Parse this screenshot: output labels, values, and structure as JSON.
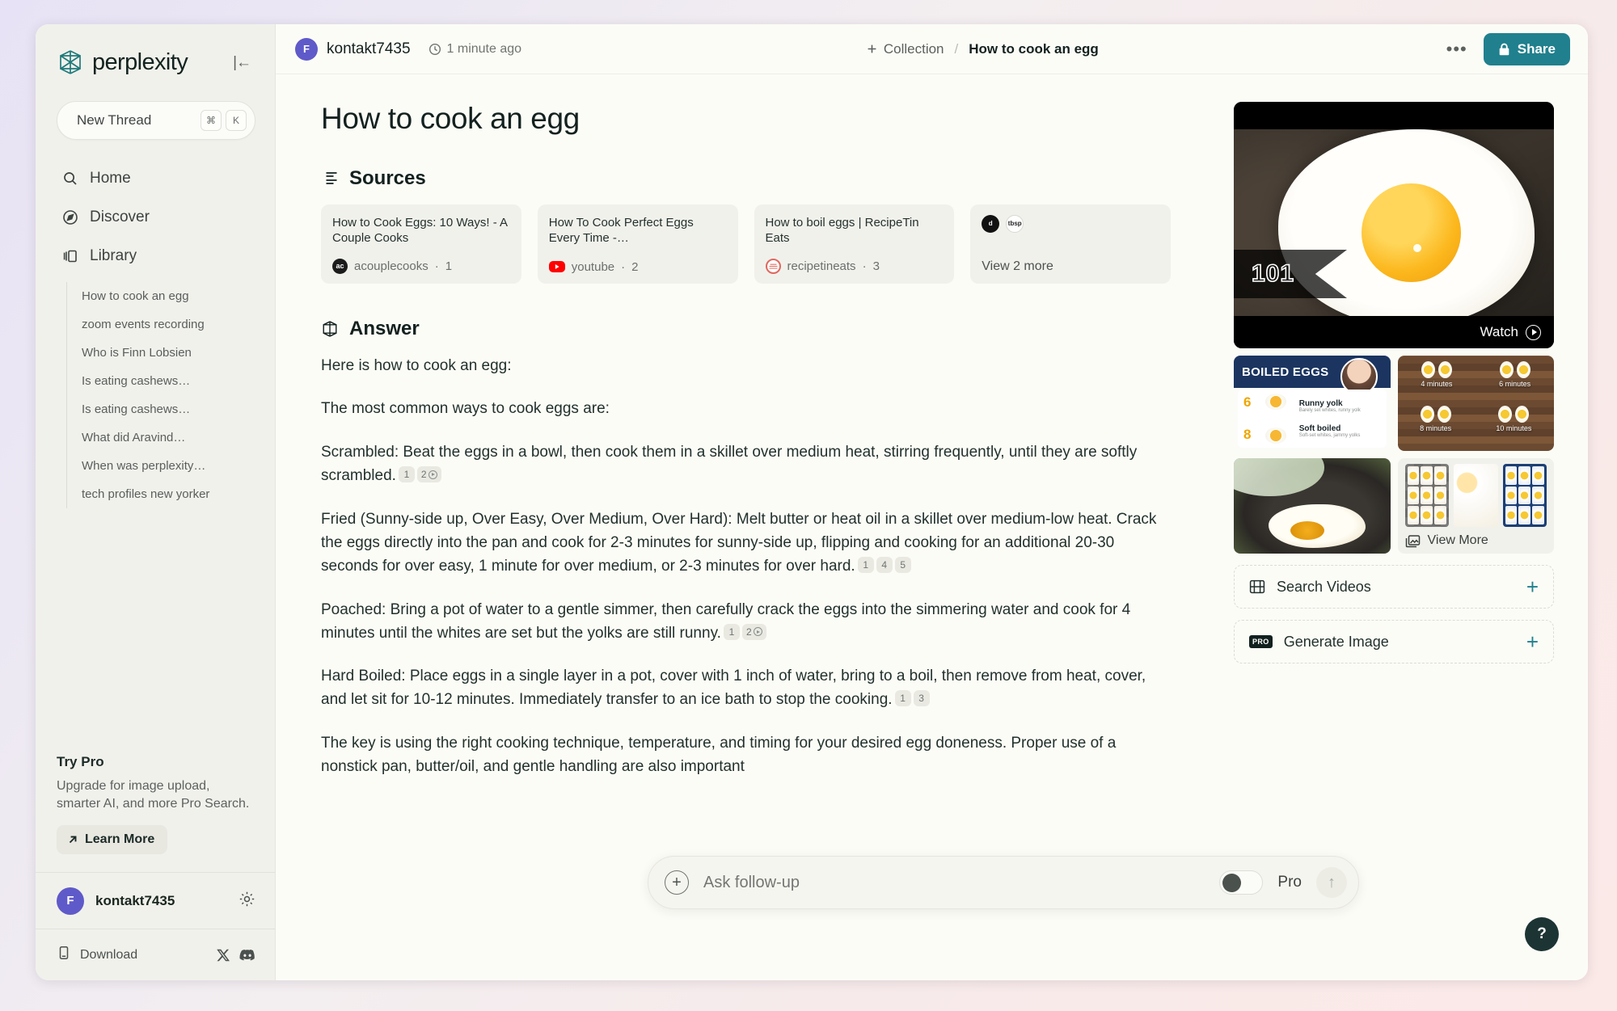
{
  "sidebar": {
    "brand": "perplexity",
    "collapse_icon": "collapse-panel-icon",
    "new_thread": {
      "label": "New Thread",
      "kbd_cmd": "⌘",
      "kbd_key": "K"
    },
    "nav": [
      {
        "label": "Home",
        "icon": "search-icon"
      },
      {
        "label": "Discover",
        "icon": "compass-icon"
      },
      {
        "label": "Library",
        "icon": "library-icon"
      }
    ],
    "threads": [
      "How to cook an egg",
      "zoom events recording",
      "Who is Finn Lobsien",
      "Is eating cashews…",
      "Is eating cashews…",
      "What did Aravind…",
      "When was perplexity…",
      "tech profiles new yorker"
    ],
    "try_pro": {
      "title": "Try Pro",
      "description": "Upgrade for image upload, smarter AI, and more Pro Search.",
      "button": "Learn More"
    },
    "user": {
      "initial": "F",
      "name": "kontakt7435",
      "settings_icon": "gear-icon"
    },
    "footer": {
      "download": "Download",
      "x_icon": "x-twitter-icon",
      "discord_icon": "discord-icon"
    }
  },
  "topbar": {
    "user_initial": "F",
    "username": "kontakt7435",
    "timestamp": "1 minute ago",
    "clock_icon": "clock-icon",
    "breadcrumb": {
      "collection": "Collection",
      "separator": "/",
      "title": "How to cook an egg"
    },
    "more_icon": "ellipsis-icon",
    "share": {
      "label": "Share",
      "icon": "lock-icon",
      "color": "#20808d"
    }
  },
  "page": {
    "title": "How to cook an egg",
    "sources_heading": "Sources",
    "answer_heading": "Answer"
  },
  "sources": [
    {
      "title": "How to Cook Eggs: 10 Ways! - A Couple Cooks",
      "domain": "acouplecooks",
      "index": "1",
      "favicon": "acouplecooks-icon"
    },
    {
      "title": "How To Cook Perfect Eggs Every Time -…",
      "domain": "youtube",
      "index": "2",
      "favicon": "youtube-icon"
    },
    {
      "title": "How to boil eggs | RecipeTin Eats",
      "domain": "recipetineats",
      "index": "3",
      "favicon": "recipetineats-icon"
    }
  ],
  "sources_more": {
    "label": "View 2 more",
    "icon_a": "delish-icon",
    "icon_b": "tbsp-icon"
  },
  "answer": {
    "intro": "Here is how to cook an egg:",
    "lead": "The most common ways to cook eggs are:",
    "paragraphs": [
      {
        "text": "Scrambled: Beat the eggs in a bowl, then cook them in a skillet over medium heat, stirring frequently, until they are softly scrambled.",
        "citations": [
          "1",
          "2"
        ],
        "has_video_cite": true
      },
      {
        "text": "Fried (Sunny-side up, Over Easy, Over Medium, Over Hard): Melt butter or heat oil in a skillet over medium-low heat. Crack the eggs directly into the pan and cook for 2-3 minutes for sunny-side up, flipping and cooking for an additional 20-30 seconds for over easy, 1 minute for over medium, or 2-3 minutes for over hard.",
        "citations": [
          "1",
          "4",
          "5"
        ],
        "has_video_cite": false
      },
      {
        "text": "Poached: Bring a pot of water to a gentle simmer, then carefully crack the eggs into the simmering water and cook for 4 minutes until the whites are set but the yolks are still runny.",
        "citations": [
          "1",
          "2"
        ],
        "has_video_cite": true
      },
      {
        "text": "Hard Boiled: Place eggs in a single layer in a pot, cover with 1 inch of water, bring to a boil, then remove from heat, cover, and let sit for 10-12 minutes. Immediately transfer to an ice bath to stop the cooking.",
        "citations": [
          "1",
          "3"
        ],
        "has_video_cite": false
      },
      {
        "text": "The key is using the right cooking technique, temperature, and timing for your desired egg doneness. Proper use of a nonstick pan, butter/oil, and gentle handling are also important",
        "citations": [],
        "has_video_cite": false
      }
    ]
  },
  "media": {
    "video": {
      "badge": "101",
      "watch_label": "Watch",
      "play_icon": "play-circle-icon"
    },
    "tiles": [
      {
        "name": "boiled-eggs-infographic",
        "band_title": "BOILED EGGS",
        "rows": [
          {
            "minutes": "6",
            "title": "Runny yolk",
            "subtitle": "Barely set whites, runny yolk"
          },
          {
            "minutes": "8",
            "title": "Soft boiled",
            "subtitle": "Soft-set whites, jammy yolks"
          }
        ]
      },
      {
        "name": "egg-timing-board",
        "labels": [
          "4 minutes",
          "6 minutes",
          "8 minutes",
          "10 minutes"
        ]
      },
      {
        "name": "skillet-fried-egg"
      },
      {
        "name": "view-more-tile",
        "label": "View More",
        "icon": "images-icon"
      }
    ],
    "actions": [
      {
        "label": "Search Videos",
        "icon": "video-grid-icon",
        "plus": "+"
      },
      {
        "label": "Generate Image",
        "icon": "pro-badge-icon",
        "badge": "PRO",
        "plus": "+"
      }
    ]
  },
  "followup": {
    "placeholder": "Ask follow-up",
    "plus_icon": "plus-circle-icon",
    "pro_label": "Pro",
    "pro_enabled": false,
    "send_icon": "arrow-up-icon"
  },
  "help": {
    "label": "?"
  }
}
